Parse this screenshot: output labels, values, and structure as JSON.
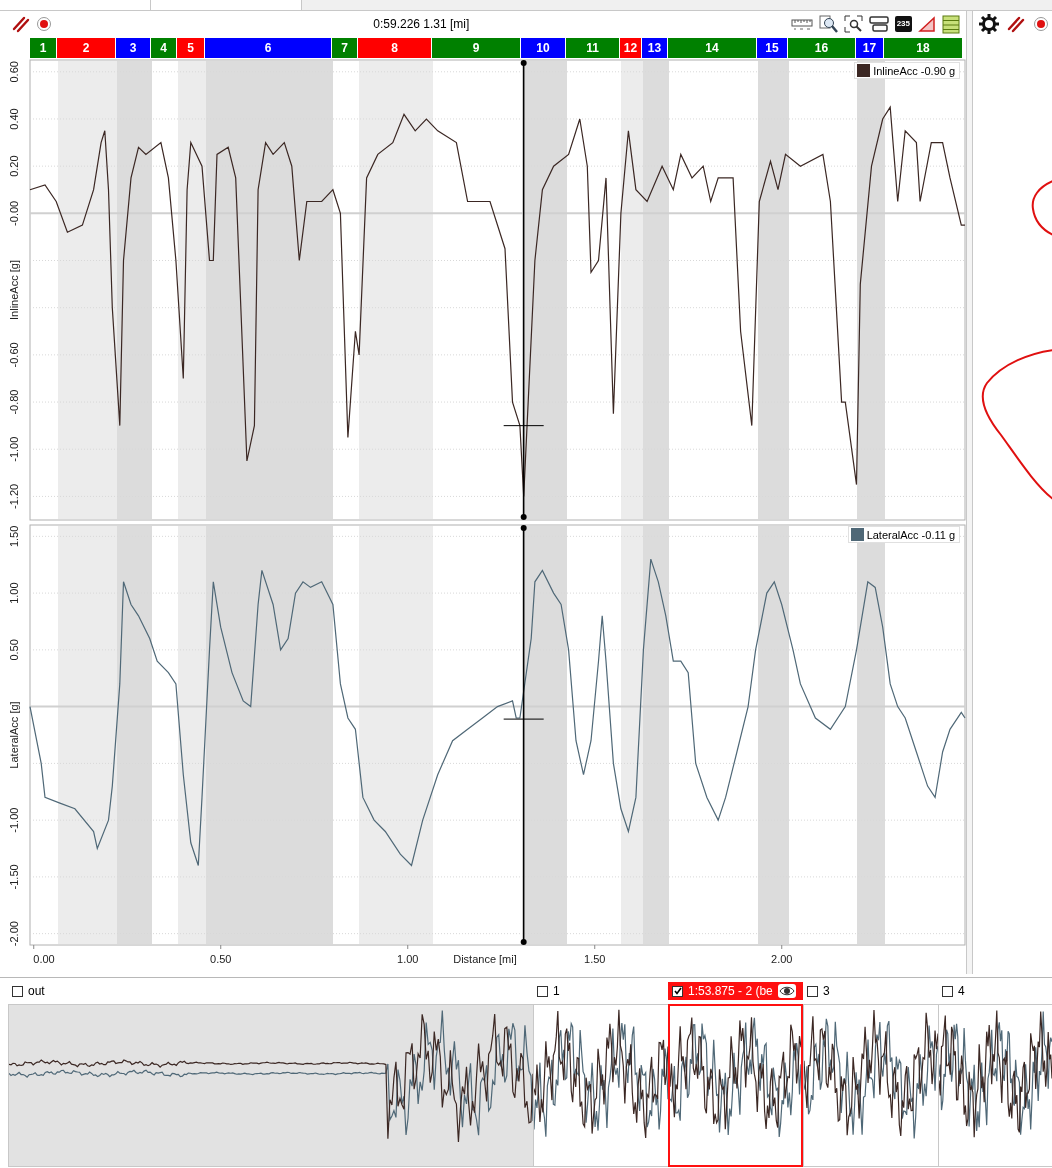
{
  "toolbar": {
    "readout": "0:59.226 1.31 [mi]",
    "badge": "235"
  },
  "sectors": [
    {
      "label": "1",
      "color": "#008000"
    },
    {
      "label": "2",
      "color": "#ff0000"
    },
    {
      "label": "3",
      "color": "#0000ff"
    },
    {
      "label": "4",
      "color": "#008000"
    },
    {
      "label": "5",
      "color": "#ff0000"
    },
    {
      "label": "6",
      "color": "#0000ff"
    },
    {
      "label": "7",
      "color": "#008000"
    },
    {
      "label": "8",
      "color": "#ff0000"
    },
    {
      "label": "9",
      "color": "#008000"
    },
    {
      "label": "10",
      "color": "#0000ff"
    },
    {
      "label": "11",
      "color": "#008000"
    },
    {
      "label": "12",
      "color": "#ff0000"
    },
    {
      "label": "13",
      "color": "#0000ff"
    },
    {
      "label": "14",
      "color": "#008000"
    },
    {
      "label": "15",
      "color": "#0000ff"
    },
    {
      "label": "16",
      "color": "#008000"
    },
    {
      "label": "17",
      "color": "#0000ff"
    },
    {
      "label": "18",
      "color": "#008000"
    }
  ],
  "plots": [
    {
      "legend": {
        "reading": "-0.90",
        "unit": "g"
      },
      "chart_data": {
        "type": "line",
        "ylabel": "InlineAcc [g]",
        "grid": true,
        "x": [
          -0.01,
          0.03,
          0.06,
          0.09,
          0.13,
          0.16,
          0.18,
          0.19,
          0.2,
          0.21,
          0.23,
          0.24,
          0.26,
          0.28,
          0.3,
          0.34,
          0.36,
          0.38,
          0.4,
          0.41,
          0.42,
          0.45,
          0.47,
          0.48,
          0.49,
          0.52,
          0.54,
          0.57,
          0.59,
          0.6,
          0.62,
          0.64,
          0.67,
          0.69,
          0.71,
          0.73,
          0.77,
          0.8,
          0.82,
          0.84,
          0.86,
          0.87,
          0.89,
          0.92,
          0.96,
          0.99,
          1.02,
          1.05,
          1.08,
          1.13,
          1.16,
          1.22,
          1.26,
          1.28,
          1.3,
          1.31,
          1.34,
          1.36,
          1.39,
          1.43,
          1.46,
          1.48,
          1.49,
          1.51,
          1.53,
          1.55,
          1.57,
          1.59,
          1.61,
          1.64,
          1.68,
          1.71,
          1.73,
          1.76,
          1.79,
          1.81,
          1.83,
          1.87,
          1.89,
          1.92,
          1.94,
          1.97,
          1.99,
          2.01,
          2.05,
          2.11,
          2.13,
          2.16,
          2.17,
          2.2,
          2.21,
          2.24,
          2.27,
          2.29,
          2.31,
          2.33,
          2.36,
          2.37,
          2.4,
          2.43,
          2.45,
          2.48,
          2.49
        ],
        "series": [
          {
            "name": "InlineAcc",
            "color": "#3b2723",
            "values": [
              0.1,
              0.12,
              0.05,
              -0.08,
              -0.05,
              0.1,
              0.3,
              0.35,
              0.1,
              -0.4,
              -0.9,
              -0.2,
              0.15,
              0.28,
              0.25,
              0.3,
              0.15,
              -0.2,
              -0.7,
              0.1,
              0.3,
              0.2,
              -0.2,
              -0.2,
              0.25,
              0.28,
              0.15,
              -1.05,
              -0.9,
              0.1,
              0.3,
              0.25,
              0.3,
              0.2,
              -0.2,
              0.05,
              0.05,
              0.1,
              0.0,
              -0.95,
              -0.5,
              -0.6,
              0.15,
              0.25,
              0.3,
              0.42,
              0.35,
              0.4,
              0.35,
              0.3,
              0.05,
              0.05,
              -0.15,
              -0.8,
              -0.9,
              -1.2,
              -0.2,
              0.1,
              0.2,
              0.25,
              0.4,
              0.2,
              -0.25,
              -0.2,
              0.15,
              -0.85,
              0.0,
              0.35,
              0.1,
              0.05,
              0.2,
              0.1,
              0.25,
              0.15,
              0.2,
              0.05,
              0.15,
              0.15,
              -0.5,
              -0.9,
              0.05,
              0.22,
              0.1,
              0.25,
              0.2,
              0.25,
              0.05,
              -0.8,
              -0.8,
              -1.15,
              -0.3,
              0.2,
              0.4,
              0.45,
              0.05,
              0.35,
              0.3,
              0.05,
              0.3,
              0.3,
              0.15,
              -0.05,
              -0.05
            ]
          }
        ],
        "xlim": [
          -0.01,
          2.49
        ],
        "ylim": [
          -1.3,
          0.65
        ],
        "yticks": [
          {
            "value": 0.6,
            "label": "0.60"
          },
          {
            "value": 0.4,
            "label": "0.40"
          },
          {
            "value": 0.2,
            "label": "0.20"
          },
          {
            "value": 0,
            "label": "-0.00"
          },
          {
            "value": -0.6,
            "label": "-0.60"
          },
          {
            "value": -0.8,
            "label": "-0.80"
          },
          {
            "value": -1.0,
            "label": "-1.00"
          },
          {
            "value": -1.2,
            "label": "-1.20"
          }
        ],
        "ref_lines": [
          {
            "axis": "x",
            "value": 1.31
          }
        ]
      }
    },
    {
      "legend": {
        "reading": "-0.11",
        "unit": "g"
      },
      "chart_data": {
        "type": "line",
        "xlabel": "Distance [mi]",
        "ylabel": "LateralAcc [g]",
        "grid": true,
        "x": [
          -0.01,
          0.02,
          0.03,
          0.07,
          0.11,
          0.16,
          0.17,
          0.2,
          0.21,
          0.23,
          0.24,
          0.26,
          0.28,
          0.31,
          0.33,
          0.36,
          0.38,
          0.4,
          0.42,
          0.44,
          0.45,
          0.47,
          0.48,
          0.5,
          0.53,
          0.56,
          0.58,
          0.6,
          0.61,
          0.64,
          0.66,
          0.68,
          0.7,
          0.72,
          0.74,
          0.77,
          0.8,
          0.82,
          0.84,
          0.86,
          0.88,
          0.91,
          0.94,
          0.98,
          1.01,
          1.04,
          1.08,
          1.12,
          1.16,
          1.2,
          1.24,
          1.28,
          1.29,
          1.3,
          1.33,
          1.34,
          1.36,
          1.39,
          1.41,
          1.43,
          1.45,
          1.47,
          1.49,
          1.51,
          1.52,
          1.53,
          1.55,
          1.57,
          1.59,
          1.61,
          1.63,
          1.65,
          1.67,
          1.69,
          1.71,
          1.73,
          1.75,
          1.77,
          1.8,
          1.83,
          1.85,
          1.88,
          1.91,
          1.93,
          1.96,
          1.98,
          2.0,
          2.03,
          2.05,
          2.09,
          2.13,
          2.17,
          2.2,
          2.23,
          2.25,
          2.27,
          2.29,
          2.31,
          2.33,
          2.36,
          2.39,
          2.41,
          2.43,
          2.45,
          2.48,
          2.49
        ],
        "series": [
          {
            "name": "LateralAcc",
            "color": "#4f6877",
            "values": [
              0.0,
              -0.5,
              -0.8,
              -0.85,
              -0.9,
              -1.1,
              -1.25,
              -1.0,
              -0.7,
              0.2,
              1.1,
              0.9,
              0.8,
              0.6,
              0.4,
              0.3,
              0.2,
              -0.6,
              -1.2,
              -1.4,
              -0.8,
              0.5,
              1.1,
              0.7,
              0.3,
              0.05,
              0.0,
              0.9,
              1.2,
              0.9,
              0.5,
              0.6,
              1.0,
              1.1,
              1.05,
              1.1,
              0.9,
              0.2,
              -0.1,
              -0.2,
              -0.8,
              -1.0,
              -1.1,
              -1.3,
              -1.4,
              -1.0,
              -0.6,
              -0.3,
              -0.2,
              -0.1,
              0.0,
              0.05,
              -0.1,
              -0.1,
              0.6,
              1.1,
              1.2,
              1.0,
              0.9,
              0.5,
              -0.3,
              -0.6,
              -0.3,
              0.4,
              0.8,
              0.4,
              -0.5,
              -0.9,
              -1.1,
              -0.8,
              0.5,
              1.3,
              1.1,
              0.8,
              0.4,
              0.4,
              0.3,
              -0.5,
              -0.8,
              -1.0,
              -0.8,
              -0.4,
              0.0,
              0.5,
              1.0,
              1.1,
              0.9,
              0.5,
              0.2,
              -0.1,
              -0.2,
              0.0,
              0.5,
              1.1,
              1.05,
              0.7,
              0.2,
              0.0,
              -0.1,
              -0.4,
              -0.7,
              -0.8,
              -0.4,
              -0.2,
              -0.05,
              -0.1
            ]
          }
        ],
        "xlim": [
          -0.01,
          2.49
        ],
        "ylim": [
          -2.1,
          1.6
        ],
        "xticks": [
          {
            "value": 0,
            "label": "0.00"
          },
          {
            "value": 0.5,
            "label": "0.50"
          },
          {
            "value": 1,
            "label": "1.00"
          },
          {
            "value": 1.5,
            "label": "1.50"
          },
          {
            "value": 2,
            "label": "2.00"
          }
        ],
        "yticks": [
          {
            "value": 1.5,
            "label": "1.50"
          },
          {
            "value": 1,
            "label": "1.00"
          },
          {
            "value": 0.5,
            "label": "0.50"
          },
          {
            "value": -1,
            "label": "-1.00"
          },
          {
            "value": -1.5,
            "label": "-1.50"
          },
          {
            "value": -2,
            "label": "-2.00"
          }
        ],
        "ref_lines": [
          {
            "axis": "x",
            "value": 1.31
          }
        ]
      }
    }
  ],
  "laps": [
    {
      "label": "out",
      "kind": "out",
      "checked": false,
      "selected": false
    },
    {
      "label": "1",
      "kind": "lap",
      "checked": false,
      "selected": false
    },
    {
      "label": "1:53.875 - 2 (be",
      "kind": "lap",
      "checked": true,
      "selected": true
    },
    {
      "label": "3",
      "kind": "lap",
      "checked": false,
      "selected": false
    },
    {
      "label": "4",
      "kind": "lap",
      "checked": false,
      "selected": false
    }
  ]
}
